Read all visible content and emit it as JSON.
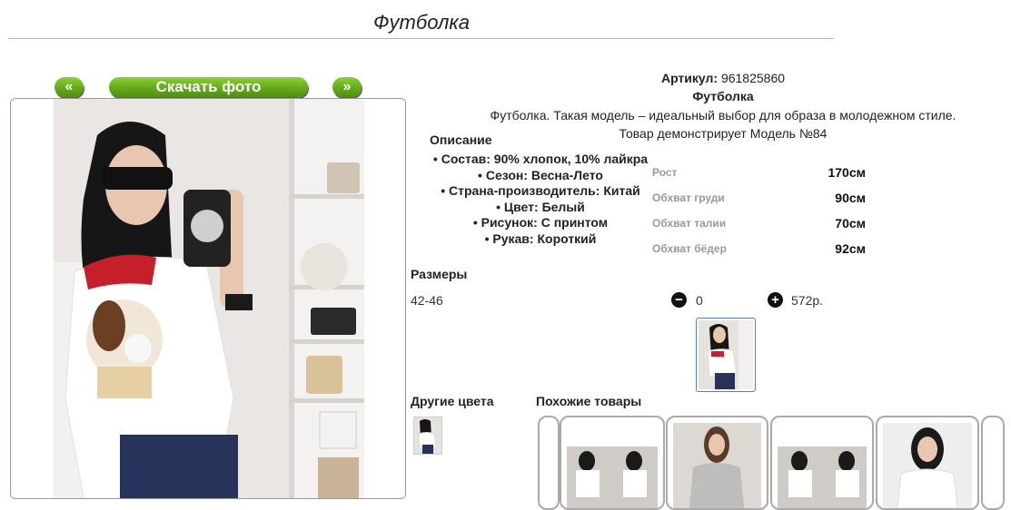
{
  "page": {
    "title": "Футболка"
  },
  "gallery": {
    "prev_label": "«",
    "download_label": "Скачать фото",
    "next_label": "»"
  },
  "product": {
    "article_label": "Артикул:",
    "article_value": "961825860",
    "name": "Футболка",
    "description": "Футболка. Такая модель – идеальный выбор для образа в молодежном стиле.",
    "model_note": "Товар демонстрирует Модель №84"
  },
  "description": {
    "heading": "Описание",
    "items": [
      "Состав: 90% хлопок, 10% лайкра",
      "Сезон: Весна-Лето",
      "Страна-производитель: Китай",
      "Цвет: Белый",
      "Рисунок: С принтом",
      "Рукав: Короткий"
    ]
  },
  "measurements": [
    {
      "label": "Рост",
      "value": "170см"
    },
    {
      "label": "Обхват груди",
      "value": "90см"
    },
    {
      "label": "Обхват талии",
      "value": "70см"
    },
    {
      "label": "Обхват бёдер",
      "value": "92см"
    }
  ],
  "sizes": {
    "heading": "Размеры",
    "range": "42-46",
    "quantity": "0",
    "price": "572р.",
    "minus_icon": "minus-icon",
    "plus_icon": "plus-icon"
  },
  "sections": {
    "other_colors": "Другие цвета",
    "similar_products": "Похожие товары"
  },
  "colors": {
    "accent_green": "#67ad1c",
    "border": "#aaaaaa",
    "muted": "#999999"
  }
}
